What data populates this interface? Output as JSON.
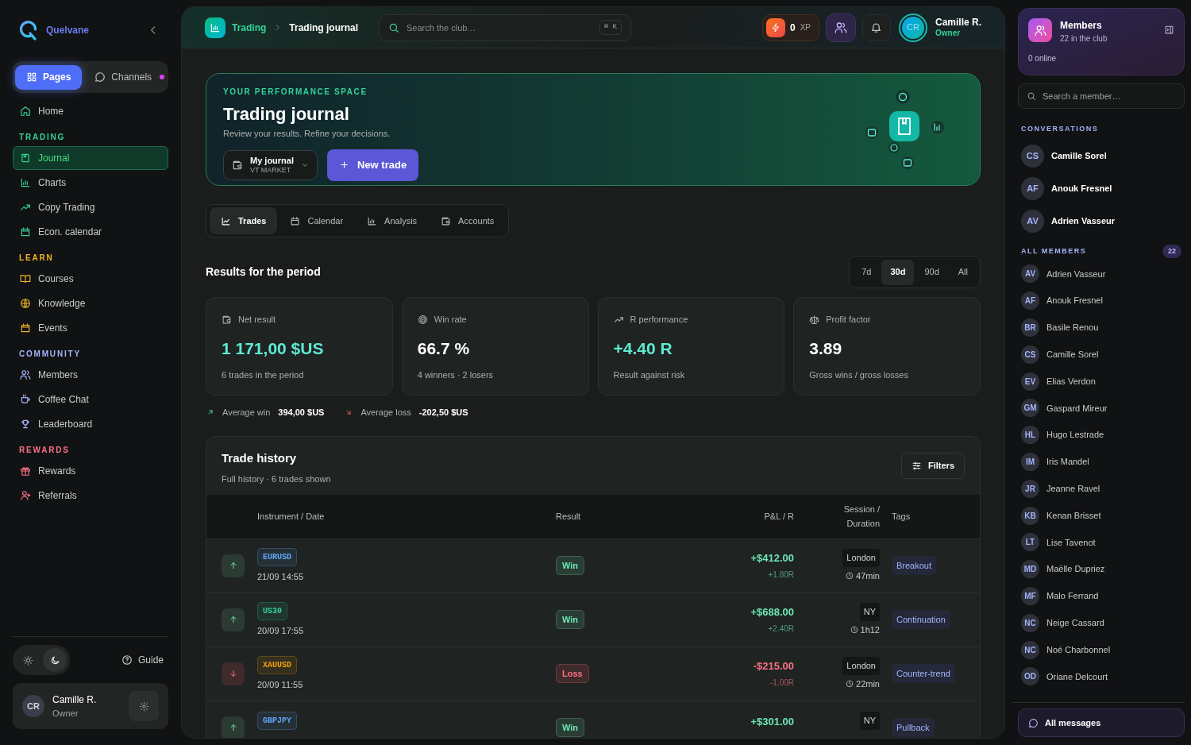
{
  "sidebar": {
    "brand": "Quelvane",
    "switch": [
      {
        "label": "Pages",
        "selected": true,
        "unread": false
      },
      {
        "label": "Channels",
        "selected": false,
        "unread": true
      }
    ],
    "nav": [
      {
        "kind": "link",
        "label": "Home",
        "selected": false
      },
      {
        "kind": "heading",
        "label": "TRADING",
        "color": "#34d399"
      },
      {
        "kind": "link",
        "label": "Journal",
        "selected": true
      },
      {
        "kind": "link",
        "label": "Charts",
        "selected": false
      },
      {
        "kind": "link",
        "label": "Copy Trading",
        "selected": false
      },
      {
        "kind": "link",
        "label": "Econ. calendar",
        "selected": false
      },
      {
        "kind": "heading",
        "label": "LEARN",
        "color": "#f0b429"
      },
      {
        "kind": "link",
        "label": "Courses",
        "selected": false
      },
      {
        "kind": "link",
        "label": "Knowledge",
        "selected": false
      },
      {
        "kind": "link",
        "label": "Events",
        "selected": false
      },
      {
        "kind": "heading",
        "label": "COMMUNITY",
        "color": "#a5b4fc"
      },
      {
        "kind": "link",
        "label": "Members",
        "selected": false
      },
      {
        "kind": "link",
        "label": "Coffee Chat",
        "selected": false
      },
      {
        "kind": "link",
        "label": "Leaderboard",
        "selected": false
      },
      {
        "kind": "heading",
        "label": "REWARDS",
        "color": "#fb7185"
      },
      {
        "kind": "link",
        "label": "Rewards",
        "selected": false
      },
      {
        "kind": "link",
        "label": "Referrals",
        "selected": false
      }
    ],
    "theme": [
      {
        "kind": "light",
        "selected": false
      },
      {
        "kind": "dark",
        "selected": true
      }
    ],
    "guide": "Guide",
    "user": {
      "initials": "CR",
      "name": "Camille R.",
      "role": "Owner"
    }
  },
  "topbar": {
    "breadcrumb": [
      "Trading",
      "Trading journal"
    ],
    "search": {
      "placeholder": "Search the club…",
      "shortcut": "⌘ K"
    },
    "xp": {
      "value": "0",
      "unit": "XP"
    },
    "user": {
      "initials": "CR",
      "name": "Camille R.",
      "role": "Owner"
    }
  },
  "hero": {
    "eyebrow": "YOUR PERFORMANCE SPACE",
    "title": "Trading journal",
    "subtitle": "Review your results. Refine your decisions.",
    "journal_select": {
      "value": "My journal",
      "sub": "VT MARKET"
    },
    "new_button": "New trade"
  },
  "tabs": [
    {
      "label": "Trades",
      "selected": true
    },
    {
      "label": "Calendar",
      "selected": false
    },
    {
      "label": "Analysis",
      "selected": false
    },
    {
      "label": "Accounts",
      "selected": false
    }
  ],
  "results": {
    "title": "Results for the period",
    "periods": [
      {
        "label": "7d",
        "selected": false
      },
      {
        "label": "30d",
        "selected": true
      },
      {
        "label": "90d",
        "selected": false
      },
      {
        "label": "All",
        "selected": false
      }
    ],
    "stats": [
      {
        "label": "Net result",
        "value": "1 171,00 $US",
        "note": "6 trades in the period",
        "highlighted": true
      },
      {
        "label": "Win rate",
        "value": "66.7 %",
        "note": "4 winners · 2 losers",
        "highlighted": false
      },
      {
        "label": "R performance",
        "value": "+4.40 R",
        "note": "Result against risk",
        "highlighted": true
      },
      {
        "label": "Profit factor",
        "value": "3.89",
        "note": "Gross wins / gross losses",
        "highlighted": false
      }
    ],
    "averages": [
      {
        "up": true,
        "label": "Average win",
        "value": "394,00 $US"
      },
      {
        "up": false,
        "label": "Average loss",
        "value": "-202,50 $US"
      }
    ]
  },
  "history": {
    "title": "Trade history",
    "subtitle": "Full history · 6 trades shown",
    "filters": "Filters",
    "columns": [
      "Instrument / Date",
      "Result",
      "P&L / R",
      "Session / Duration",
      "Tags"
    ],
    "rows": [
      {
        "up": true,
        "instrument": "EURUSD",
        "color": "#60a5fa",
        "date": "21/09 14:55",
        "result": "Win",
        "loss": false,
        "pnl": "+$412.00",
        "r": "+1.80R",
        "session": "London",
        "duration": "47min",
        "tag": "Breakout"
      },
      {
        "up": true,
        "instrument": "US30",
        "color": "#34d399",
        "date": "20/09 17:55",
        "result": "Win",
        "loss": false,
        "pnl": "+$688.00",
        "r": "+2.40R",
        "session": "NY",
        "duration": "1h12",
        "tag": "Continuation"
      },
      {
        "up": false,
        "instrument": "XAUUSD",
        "color": "#f59e0b",
        "date": "20/09 11:55",
        "result": "Loss",
        "loss": true,
        "pnl": "-$215.00",
        "r": "-1.00R",
        "session": "London",
        "duration": "22min",
        "tag": "Counter-trend"
      },
      {
        "up": true,
        "instrument": "GBPJPY",
        "color": "#60a5fa",
        "result": "Win",
        "loss": false,
        "pnl": "+$301.00",
        "session": "NY",
        "tag": "Pullback"
      }
    ]
  },
  "members": {
    "title": "Members",
    "count": "22 in the club",
    "online": "0 online",
    "search": {
      "placeholder": "Search a member…"
    },
    "conversations_title": "CONVERSATIONS",
    "conversations": [
      {
        "initials": "CS",
        "name": "Camille Sorel"
      },
      {
        "initials": "AF",
        "name": "Anouk Fresnel"
      },
      {
        "initials": "AV",
        "name": "Adrien Vasseur"
      }
    ],
    "all_title": "ALL MEMBERS",
    "all_count": "22",
    "list": [
      {
        "initials": "AV",
        "name": "Adrien Vasseur"
      },
      {
        "initials": "AF",
        "name": "Anouk Fresnel"
      },
      {
        "initials": "BR",
        "name": "Basile Renou"
      },
      {
        "initials": "CS",
        "name": "Camille Sorel"
      },
      {
        "initials": "EV",
        "name": "Elias Verdon"
      },
      {
        "initials": "GM",
        "name": "Gaspard Mireur"
      },
      {
        "initials": "HL",
        "name": "Hugo Lestrade"
      },
      {
        "initials": "IM",
        "name": "Iris Mandel"
      },
      {
        "initials": "JR",
        "name": "Jeanne Ravel"
      },
      {
        "initials": "KB",
        "name": "Kenan Brisset"
      },
      {
        "initials": "LT",
        "name": "Lise Tavenot"
      },
      {
        "initials": "MD",
        "name": "Maëlle Dupriez"
      },
      {
        "initials": "MF",
        "name": "Malo Ferrand"
      },
      {
        "initials": "NC",
        "name": "Neige Cassard"
      },
      {
        "initials": "NC",
        "name": "Noé Charbonnel"
      },
      {
        "initials": "OD",
        "name": "Oriane Delcourt"
      }
    ],
    "all_messages": "All messages"
  }
}
